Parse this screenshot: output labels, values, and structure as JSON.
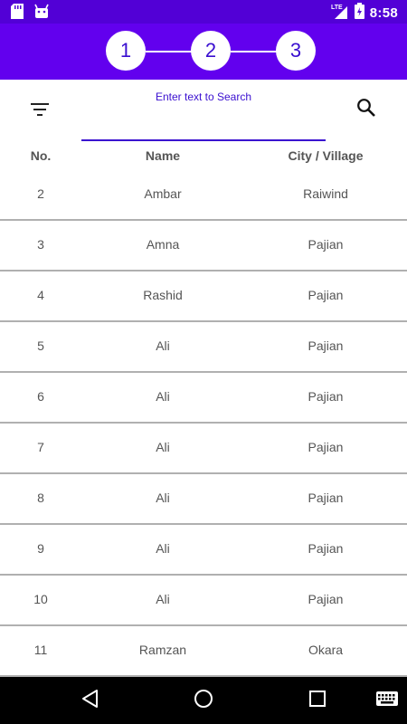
{
  "status_bar": {
    "time": "8:58",
    "network": "LTE",
    "icons": [
      "sd-card-icon",
      "android-icon",
      "signal-icon",
      "battery-icon"
    ]
  },
  "stepper": {
    "steps": [
      "1",
      "2",
      "3"
    ],
    "colors": {
      "header_bg": "#6200ee",
      "statusbar_bg": "#5200d6",
      "step_text": "#3a0fd0"
    }
  },
  "search": {
    "hint": "Enter text to Search",
    "value": "",
    "filter_icon": "filter-icon",
    "search_icon": "search-icon"
  },
  "table": {
    "headers": {
      "no": "No.",
      "name": "Name",
      "city": "City / Village"
    },
    "rows": [
      {
        "no": "2",
        "name": "Ambar",
        "city": "Raiwind"
      },
      {
        "no": "3",
        "name": "Amna",
        "city": "Pajian"
      },
      {
        "no": "4",
        "name": "Rashid",
        "city": "Pajian"
      },
      {
        "no": "5",
        "name": "Ali",
        "city": "Pajian"
      },
      {
        "no": "6",
        "name": "Ali",
        "city": "Pajian"
      },
      {
        "no": "7",
        "name": "Ali",
        "city": "Pajian"
      },
      {
        "no": "8",
        "name": "Ali",
        "city": "Pajian"
      },
      {
        "no": "9",
        "name": "Ali",
        "city": "Pajian"
      },
      {
        "no": "10",
        "name": "Ali",
        "city": "Pajian"
      },
      {
        "no": "11",
        "name": "Ramzan",
        "city": "Okara"
      }
    ]
  },
  "nav_bar": {
    "buttons": [
      "back-icon",
      "home-icon",
      "recents-icon",
      "keyboard-icon"
    ]
  }
}
